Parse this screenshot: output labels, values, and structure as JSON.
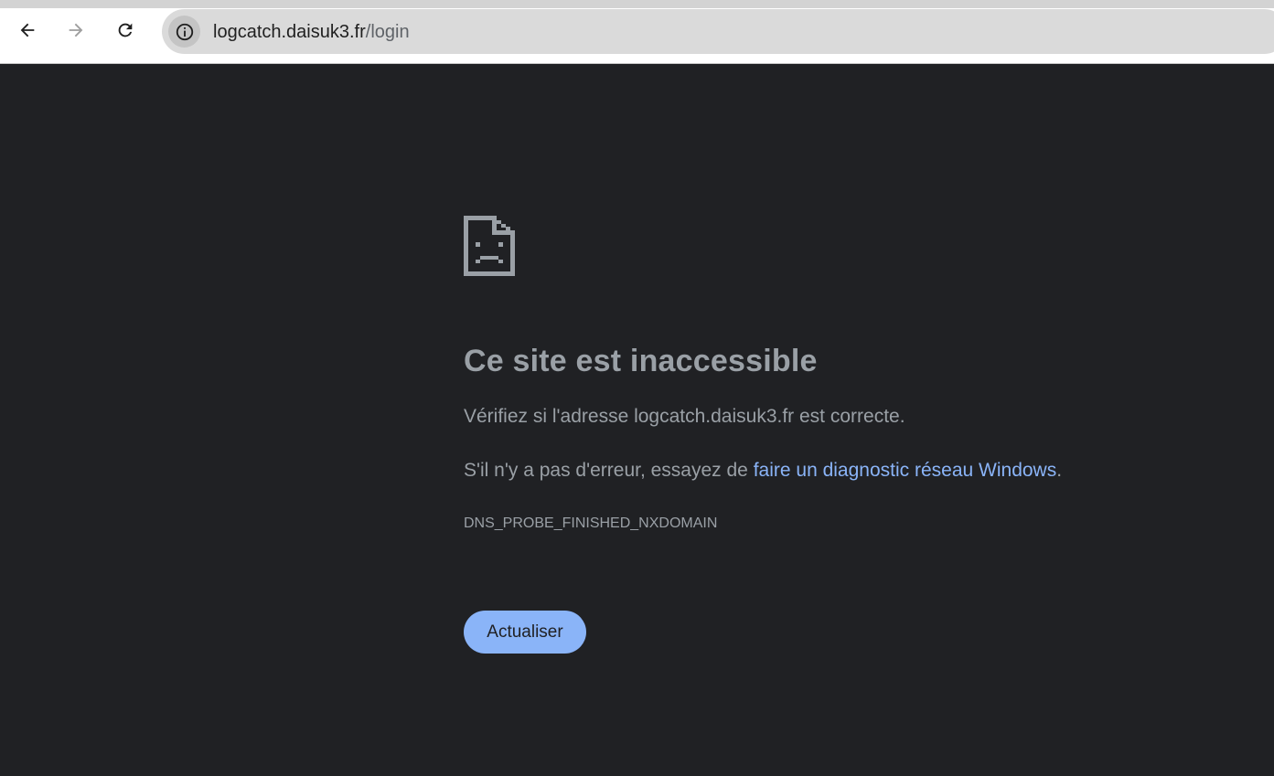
{
  "browser": {
    "url_host": "logcatch.daisuk3.fr",
    "url_path": "/login",
    "icons": {
      "back": "arrow-left-icon",
      "forward": "arrow-right-icon",
      "reload": "reload-icon",
      "site_info": "info-icon"
    }
  },
  "error_page": {
    "icon": "sad-document-icon",
    "title": "Ce site est inaccessible",
    "line1": "Vérifiez si l'adresse logcatch.daisuk3.fr est correcte.",
    "line2_prefix": "S'il n'y a pas d'erreur, essayez de ",
    "line2_link": "faire un diagnostic réseau Windows",
    "line2_suffix": ".",
    "error_code": "DNS_PROBE_FINISHED_NXDOMAIN",
    "reload_label": "Actualiser"
  },
  "colors": {
    "page_background": "#202124",
    "text": "#9aa0a6",
    "link": "#8ab4f8",
    "button": "#8ab4f8"
  }
}
